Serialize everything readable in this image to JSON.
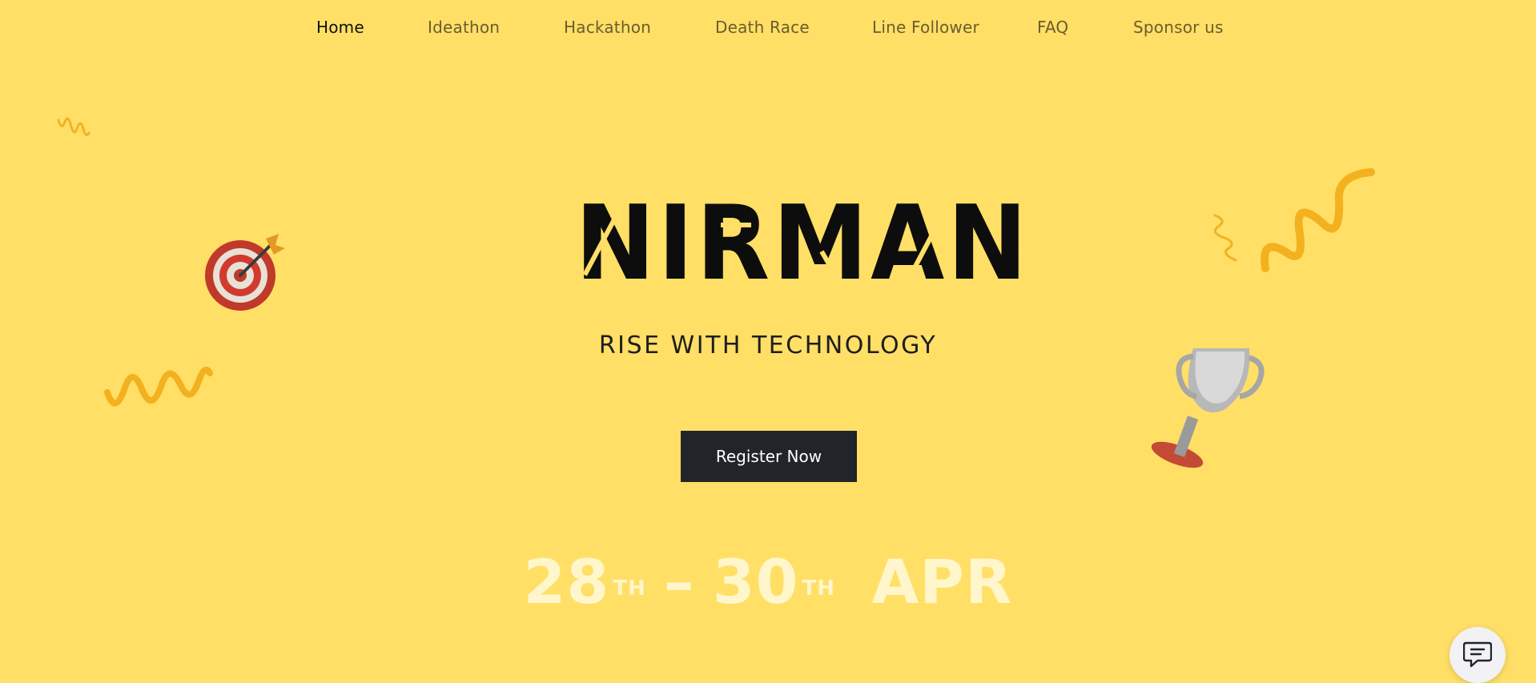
{
  "nav": {
    "items": [
      {
        "label": "Home"
      },
      {
        "label": "Ideathon"
      },
      {
        "label": "Hackathon"
      },
      {
        "label": "Death Race"
      },
      {
        "label": "Line Follower"
      },
      {
        "label": "FAQ"
      },
      {
        "label": "Sponsor us"
      }
    ],
    "active": "Home"
  },
  "hero": {
    "logo_text": "NIRMAN",
    "tagline": "RISE WITH TECHNOLOGY",
    "cta_label": "Register Now",
    "dates": {
      "start": "28",
      "start_suffix": "TH",
      "separator": "–",
      "end": "30",
      "end_suffix": "TH",
      "month": "APR"
    }
  },
  "decorations": {
    "dartboard": "dartboard-icon",
    "trophy": "trophy-icon",
    "squiggles": "squiggle-icon",
    "chat": "chat-bubble-icon"
  },
  "colors": {
    "background": "#FFDF66",
    "button": "#212429",
    "date_text": "#FFF6CC",
    "squiggle": "#F5B81F"
  }
}
